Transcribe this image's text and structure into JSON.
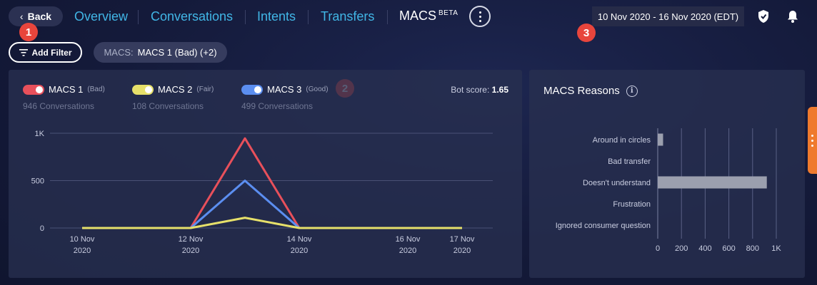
{
  "nav": {
    "back_label": "Back",
    "items": [
      "Overview",
      "Conversations",
      "Intents",
      "Transfers"
    ],
    "active_label": "MACS",
    "active_badge": "BETA",
    "date_range": "10 Nov 2020 - 16 Nov 2020 (EDT)"
  },
  "annotations": [
    "1",
    "2",
    "3"
  ],
  "filters": {
    "add_label": "Add Filter",
    "chip_key": "MACS:",
    "chip_value": "MACS 1 (Bad) (+2)"
  },
  "legend": [
    {
      "name": "MACS 1",
      "quality": "(Bad)",
      "count": "946 Conversations",
      "color": "#e8505b",
      "enabled": true
    },
    {
      "name": "MACS 2",
      "quality": "(Fair)",
      "count": "108 Conversations",
      "color": "#e6e06a",
      "enabled": true
    },
    {
      "name": "MACS 3",
      "quality": "(Good)",
      "count": "499 Conversations",
      "color": "#5b8ef0",
      "enabled": true
    }
  ],
  "bot_score": {
    "label": "Bot score:",
    "value": "1.65"
  },
  "reasons": {
    "title": "MACS Reasons"
  },
  "chart_data": [
    {
      "type": "line",
      "x": [
        "2020-11-10",
        "2020-11-11",
        "2020-11-12",
        "2020-11-13",
        "2020-11-14",
        "2020-11-15",
        "2020-11-16",
        "2020-11-17"
      ],
      "xtick_values": [
        "2020-11-10",
        "2020-11-12",
        "2020-11-14",
        "2020-11-16",
        "2020-11-17"
      ],
      "xtick_labels": [
        [
          "10 Nov",
          "2020"
        ],
        [
          "12 Nov",
          "2020"
        ],
        [
          "14 Nov",
          "2020"
        ],
        [
          "16 Nov",
          "2020"
        ],
        [
          "17 Nov",
          "2020"
        ]
      ],
      "yticks": [
        0,
        500,
        1000
      ],
      "ytick_labels": [
        "0",
        "500",
        "1K"
      ],
      "ylim": [
        0,
        1000
      ],
      "series": [
        {
          "name": "MACS 1",
          "color": "#e8505b",
          "values": [
            0,
            0,
            0,
            946,
            0,
            0,
            0,
            0
          ]
        },
        {
          "name": "MACS 3",
          "color": "#5b8ef0",
          "values": [
            0,
            0,
            0,
            499,
            0,
            0,
            0,
            0
          ]
        },
        {
          "name": "MACS 2",
          "color": "#e6e06a",
          "values": [
            0,
            0,
            0,
            108,
            0,
            0,
            0,
            0
          ]
        }
      ],
      "grid": true
    },
    {
      "type": "bar",
      "orientation": "horizontal",
      "categories": [
        "Around in circles",
        "Bad transfer",
        "Doesn't understand",
        "Frustration",
        "Ignored consumer question"
      ],
      "values": [
        45,
        0,
        920,
        0,
        0
      ],
      "xlim": [
        0,
        1000
      ],
      "xticks": [
        0,
        200,
        400,
        600,
        800,
        1000
      ],
      "xtick_labels": [
        "0",
        "200",
        "400",
        "600",
        "800",
        "1K"
      ],
      "bar_color": "#9b9fae",
      "grid": true
    }
  ]
}
